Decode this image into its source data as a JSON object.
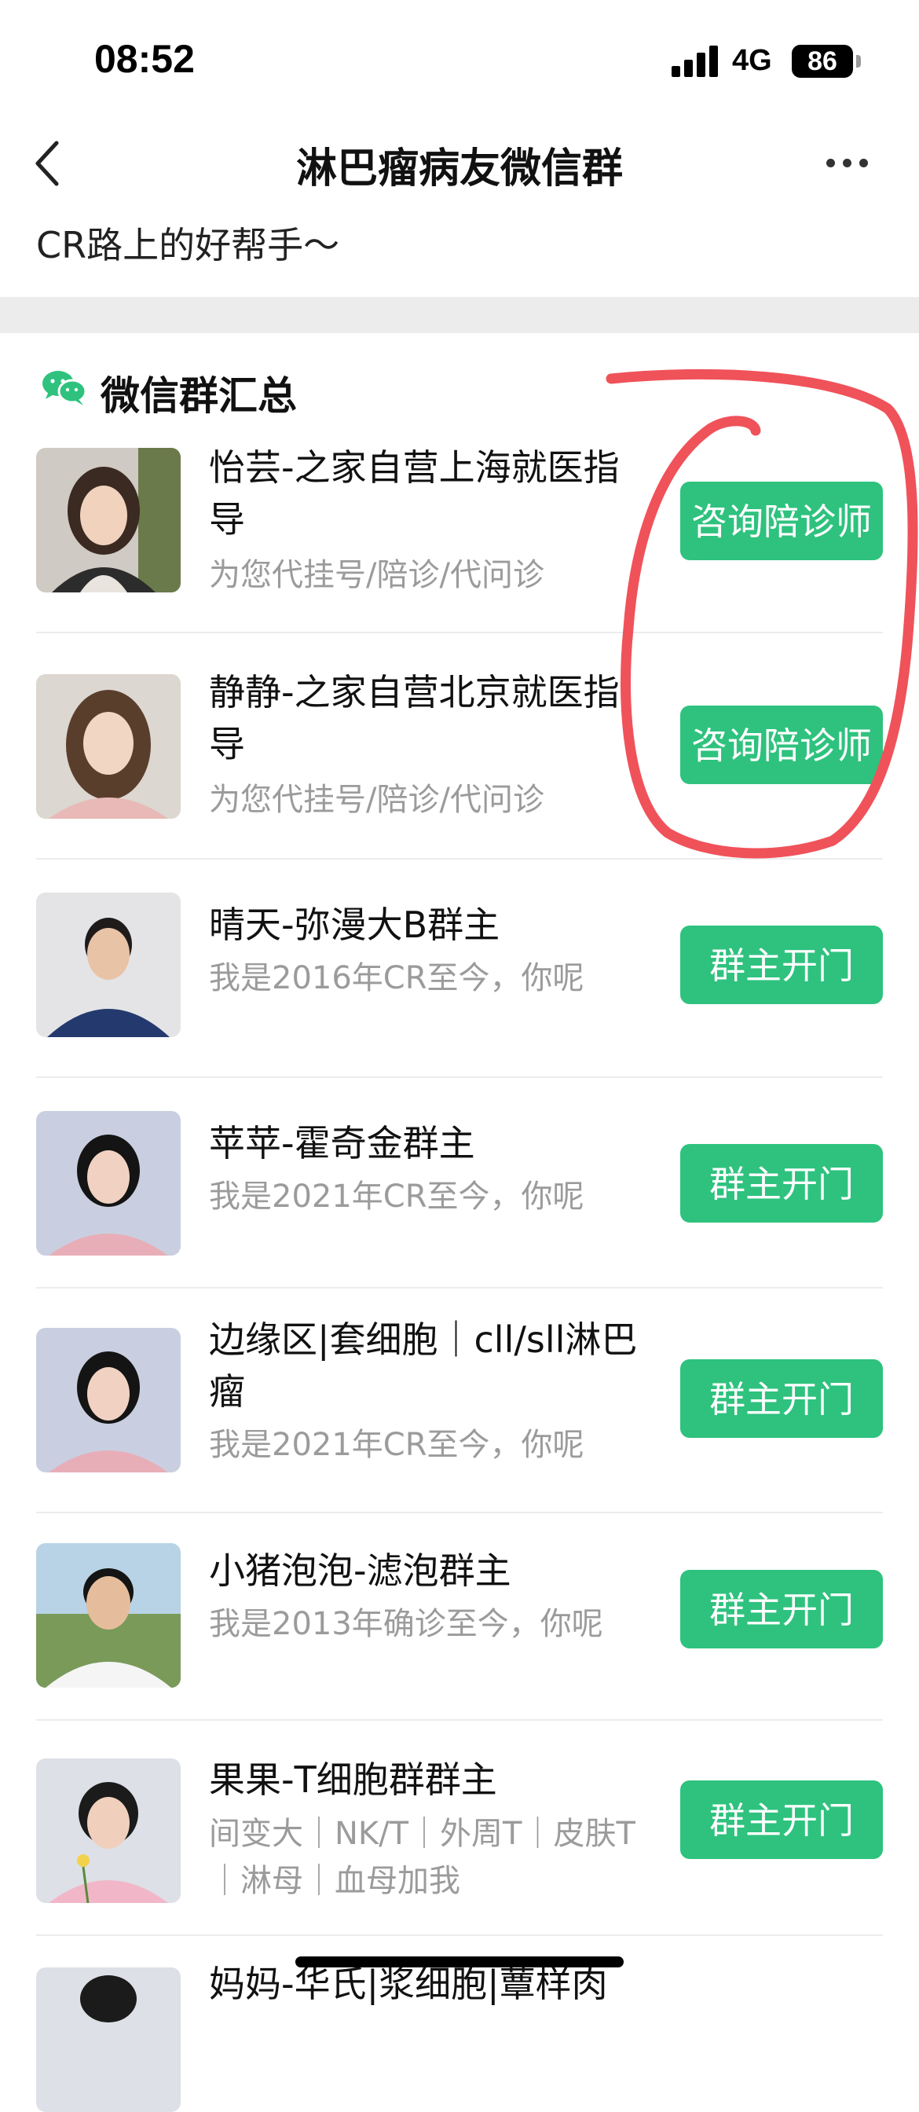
{
  "status_bar": {
    "time": "08:52",
    "network": "4G",
    "battery": "86"
  },
  "nav": {
    "title": "淋巴瘤病友微信群"
  },
  "subtitle": "CR路上的好帮手～",
  "section": {
    "title": "微信群汇总"
  },
  "items": [
    {
      "name": "怡芸-之家自营上海就医指导",
      "desc": "为您代挂号/陪诊/代问诊",
      "button": "咨询陪诊师"
    },
    {
      "name": "静静-之家自营北京就医指导",
      "desc": "为您代挂号/陪诊/代问诊",
      "button": "咨询陪诊师"
    },
    {
      "name": "晴天-弥漫大B群主",
      "desc": "我是2016年CR至今，你呢",
      "button": "群主开门"
    },
    {
      "name": "苹苹-霍奇金群主",
      "desc": "我是2021年CR至今，你呢",
      "button": "群主开门"
    },
    {
      "name": "边缘区|套细胞｜cll/sll淋巴瘤",
      "desc": "我是2021年CR至今，你呢",
      "button": "群主开门"
    },
    {
      "name": "小猪泡泡-滤泡群主",
      "desc": "我是2013年确诊至今，你呢",
      "button": "群主开门"
    },
    {
      "name": "果果-T细胞群群主",
      "desc": "间变大｜NK/T｜外周T｜皮肤T｜淋母｜血母加我",
      "button": "群主开门"
    },
    {
      "name": "妈妈-华氏|浆细胞|蕈样肉",
      "desc": "",
      "button": ""
    }
  ]
}
